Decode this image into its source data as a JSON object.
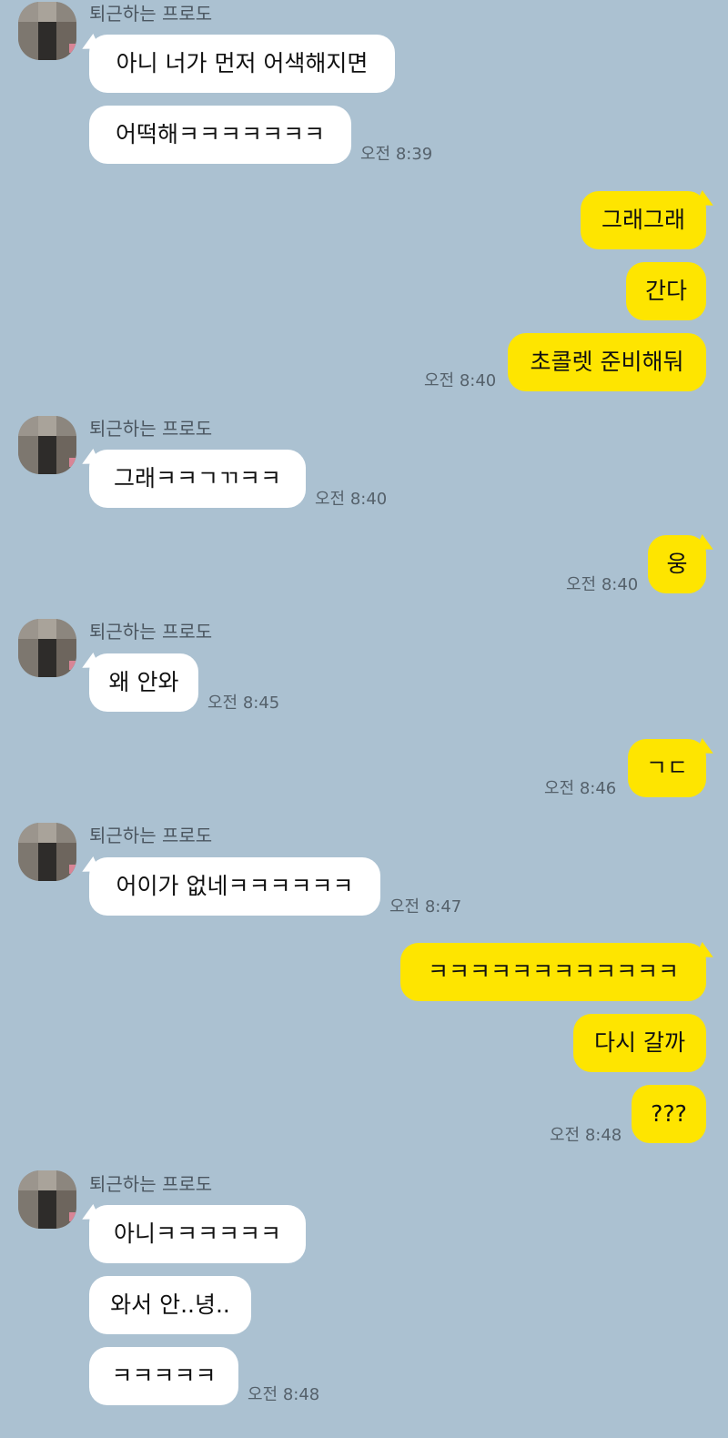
{
  "contact_name": "퇴근하는 프로도",
  "messages": {
    "m1": "아니 너가 먼저 어색해지면",
    "m2": "어떡해ㅋㅋㅋㅋㅋㅋㅋ",
    "m3": "그래그래",
    "m4": "간다",
    "m5": "초콜렛 준비해둬",
    "m6": "그래ㅋㅋㄱㄲㅋㅋ",
    "m7": "웅",
    "m8": "왜 안와",
    "m9": "ㄱㄷ",
    "m10": "어이가 없네ㅋㅋㅋㅋㅋㅋ",
    "m11": "ㅋㅋㅋㅋㅋㅋㅋㅋㅋㅋㅋㅋ",
    "m12": "다시 갈까",
    "m13": "???",
    "m14": "아니ㅋㅋㅋㅋㅋㅋ",
    "m15": "와서 안..녕..",
    "m16": "ㅋㅋㅋㅋㅋ"
  },
  "times": {
    "t1": "오전 8:39",
    "t2": "오전 8:40",
    "t3": "오전 8:40",
    "t4": "오전 8:40",
    "t5": "오전 8:45",
    "t6": "오전 8:46",
    "t7": "오전 8:47",
    "t8": "오전 8:48",
    "t9": "오전 8:48"
  },
  "colors": {
    "background": "#abc1d1",
    "incoming_bubble": "#ffffff",
    "outgoing_bubble": "#fee500"
  },
  "avatar_icon": "pixelated-profile-photo"
}
